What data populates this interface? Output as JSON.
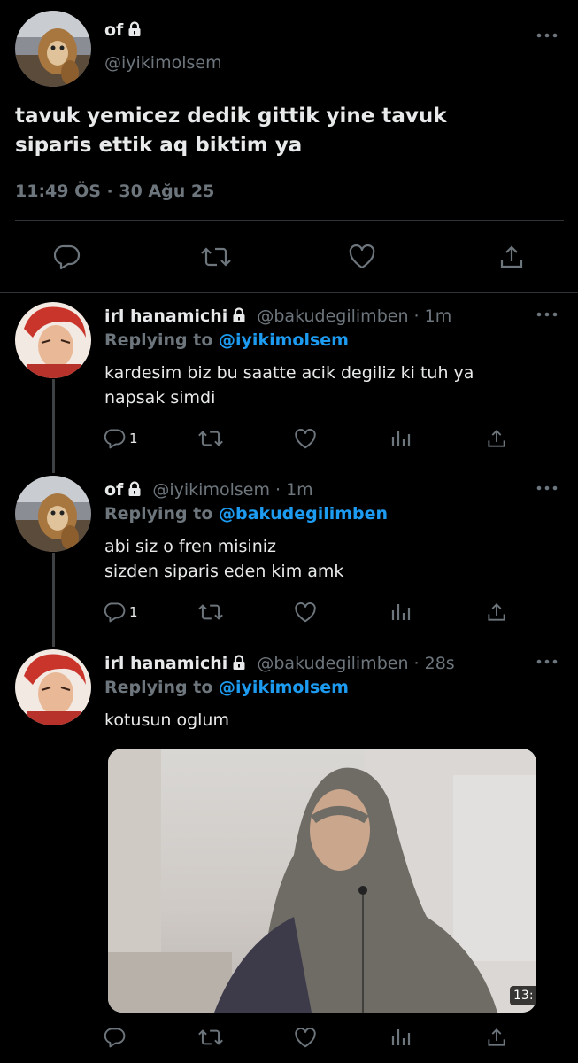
{
  "main_tweet": {
    "display_name": "of",
    "handle": "@iyikimolsem",
    "text_line1": "tavuk yemicez dedik gittik yine tavuk",
    "text_line2": "siparis ettik aq biktim ya",
    "timestamp": "11:49 ÖS · 30 Ağu 25"
  },
  "replies": [
    {
      "display_name": "irl hanamichi",
      "handle_time": "@bakudegilimben · 1m",
      "replying_prefix": "Replying to ",
      "replying_to": "@iyikimolsem",
      "text_line1": "kardesim biz bu saatte acik degiliz ki tuh ya",
      "text_line2": "napsak simdi",
      "reply_count": "1"
    },
    {
      "display_name": "of",
      "handle_time": "@iyikimolsem · 1m",
      "replying_prefix": "Replying to ",
      "replying_to": "@bakudegilimben",
      "text_line1": "abi siz o fren misiniz",
      "text_line2": "sizden siparis eden kim amk",
      "reply_count": "1"
    },
    {
      "display_name": "irl hanamichi",
      "handle_time": "@bakudegilimben · 28s",
      "replying_prefix": "Replying to ",
      "replying_to": "@iyikimolsem",
      "text_line1": "kotusun oglum",
      "media_duration": "13:"
    }
  ],
  "icons": {
    "more": "more-icon",
    "reply": "reply-icon",
    "retweet": "retweet-icon",
    "like": "like-icon",
    "share": "share-icon",
    "views": "views-icon",
    "lock": "lock-icon"
  },
  "colors": {
    "background": "#000000",
    "text": "#e7e9ea",
    "muted": "#6e767d",
    "link": "#1d9bf0",
    "divider": "#2f3336"
  }
}
